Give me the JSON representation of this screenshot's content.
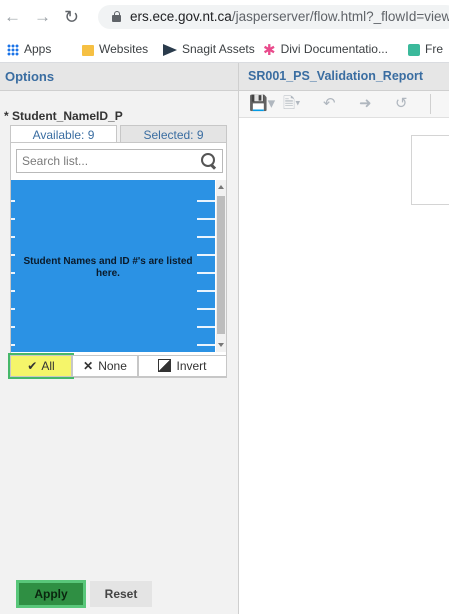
{
  "browser": {
    "url_host": "ers.ece.gov.nt.ca",
    "url_path": "/jasperserver/flow.html?_flowId=viewR",
    "bookmarks": [
      "Apps",
      "Websites",
      "Snagit Assets",
      "Divi Documentatio...",
      "Fre"
    ]
  },
  "options_panel": {
    "header": "Options",
    "param_label": "* Student_NameID_P",
    "tab_available": "Available: 9",
    "tab_selected": "Selected: 9",
    "search_placeholder": "Search list...",
    "blurred_message": "Student Names and ID #'s are listed here.",
    "btn_all": "All",
    "btn_none": "None",
    "btn_invert": "Invert",
    "apply": "Apply",
    "reset": "Reset"
  },
  "report_panel": {
    "title": "SR001_PS_Validation_Report"
  },
  "colors": {
    "header_text": "#3a6da1",
    "highlight": "#f5f56a",
    "highlight_border": "#46b86a",
    "apply_bg": "#2f8f43"
  }
}
